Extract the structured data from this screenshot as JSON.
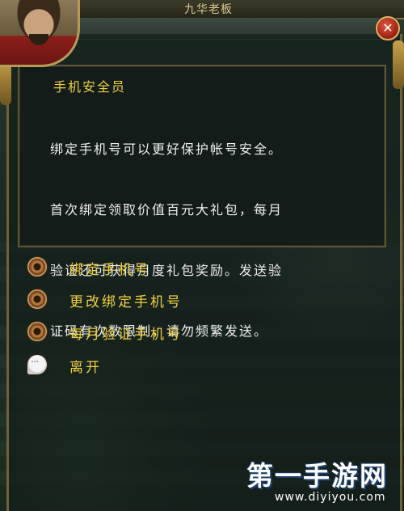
{
  "header": {
    "top_title": "九华老板"
  },
  "dialog": {
    "title": "手机安全员",
    "body_lines": [
      "绑定手机号可以更好保护帐号安全。",
      "首次绑定领取价值百元大礼包，每月",
      "验证还可获得月度礼包奖励。发送验",
      "证码有次数限制，请勿频繁发送。"
    ],
    "close_label": "✕"
  },
  "options": [
    {
      "label": "绑定手机号",
      "icon": "bronze-coin-icon"
    },
    {
      "label": "更改绑定手机号",
      "icon": "bronze-coin-icon"
    },
    {
      "label": "每月验证手机号",
      "icon": "bronze-coin-icon"
    },
    {
      "label": "离开",
      "icon": "speech-bubble-icon"
    }
  ],
  "watermark": {
    "brand": "第一手游网",
    "url": "www.diyiyou.com"
  },
  "colors": {
    "title_gold": "#f0d040",
    "body_text": "#eeeeee",
    "panel_border": "#6e6238"
  }
}
